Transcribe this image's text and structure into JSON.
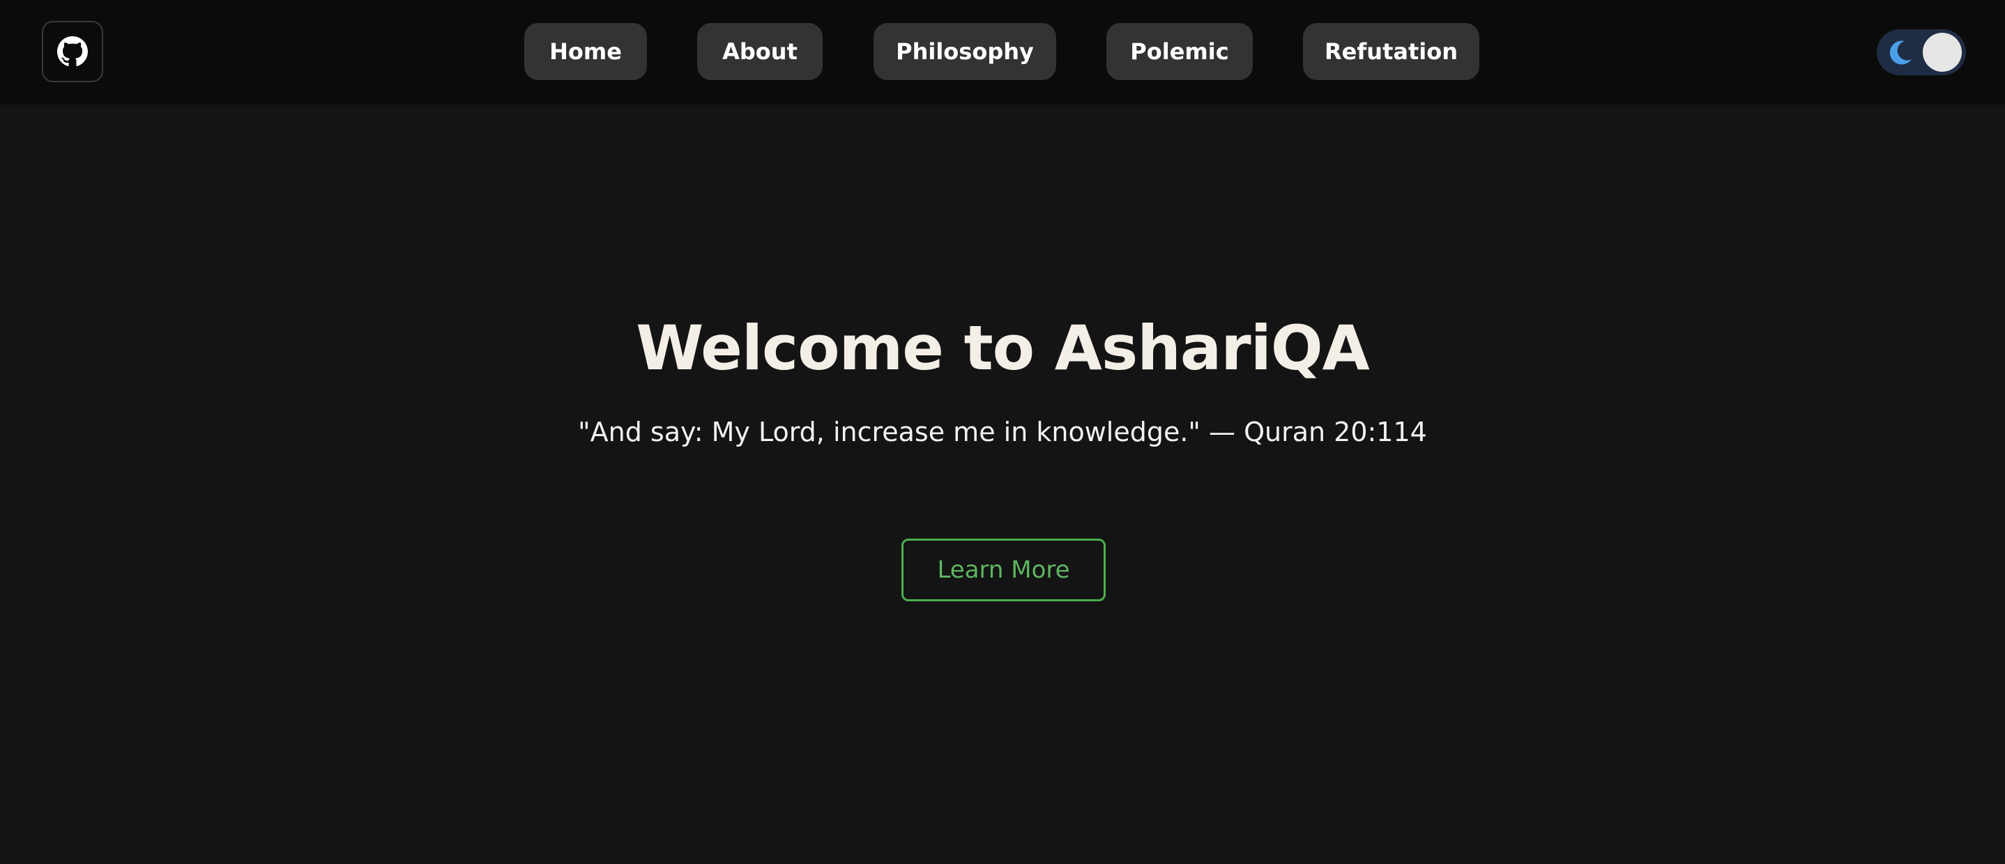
{
  "header": {
    "github_icon": "github-icon",
    "nav": [
      {
        "label": "Home"
      },
      {
        "label": "About"
      },
      {
        "label": "Philosophy"
      },
      {
        "label": "Polemic"
      },
      {
        "label": "Refutation"
      }
    ],
    "theme_toggle": {
      "icon": "moon-icon",
      "state": "dark",
      "accent": "#4a9fe8"
    }
  },
  "hero": {
    "title": "Welcome to AshariQA",
    "quote": "\"And say: My Lord, increase me in knowledge.\" — Quran 20:114",
    "cta_label": "Learn More"
  },
  "colors": {
    "background": "#141414",
    "topbar": "#0b0b0b",
    "nav_pill": "#333333",
    "title": "#f4efe6",
    "cta": "#4caf50"
  }
}
